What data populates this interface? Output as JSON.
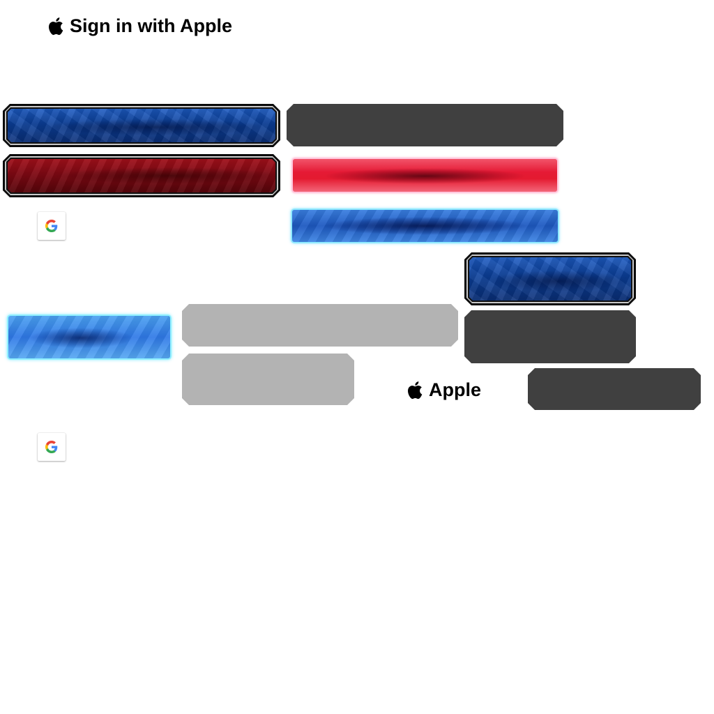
{
  "apple_signin": {
    "label": "Sign in with Apple",
    "icon": "apple-logo-icon"
  },
  "apple_short": {
    "label": "Apple",
    "icon": "apple-logo-icon"
  },
  "google_buttons": [
    {
      "icon": "google-g-icon"
    },
    {
      "icon": "google-g-icon"
    }
  ],
  "colors": {
    "framed_blue": "#0b3f9a",
    "framed_red": "#7a0812",
    "glow_red": "#e51a35",
    "glow_blue": "#1d58c0",
    "glow_light_blue": "#2f78e6",
    "plate_dark": "#404040",
    "plate_gray": "#b3b3b3",
    "google_blue": "#4285F4",
    "google_red": "#EA4335",
    "google_yellow": "#FBBC05",
    "google_green": "#34A853"
  }
}
